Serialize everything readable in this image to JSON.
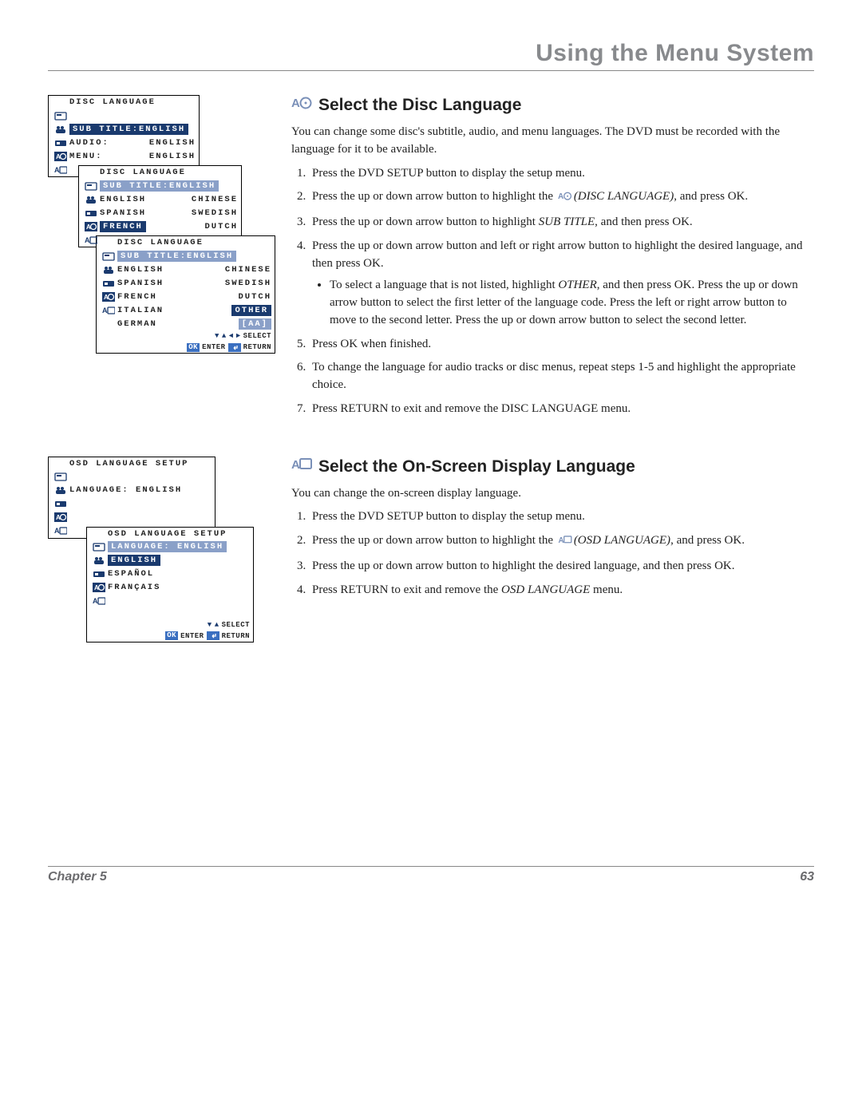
{
  "header": {
    "title": "Using the Menu System"
  },
  "footer": {
    "chapter": "Chapter 5",
    "page": "63"
  },
  "section1": {
    "title": "Select the Disc Language",
    "intro": "You can change some disc's subtitle, audio, and menu languages. The DVD must be recorded with the language for it to be available.",
    "steps": {
      "s1": "Press the DVD SETUP button to display the setup menu.",
      "s2a": "Press the up or down arrow button to highlight the ",
      "s2b": "(DISC LANGUAGE)",
      "s2c": ", and press OK.",
      "s3a": "Press the up or down arrow button to highlight ",
      "s3b": "SUB TITLE",
      "s3c": ", and then press OK.",
      "s4": "Press the up or down arrow button and left or right arrow button to highlight the desired language, and then press OK.",
      "s4bul_a": "To select a language that is not listed, highlight ",
      "s4bul_b": "OTHER",
      "s4bul_c": ", and then press OK. Press the up or down arrow button to select the first letter of the language code. Press the left or right arrow button to move to the second letter. Press the up or down arrow button to select the second letter.",
      "s5": "Press OK when finished.",
      "s6": "To change the language for audio tracks or disc menus, repeat steps 1-5 and highlight the appropriate choice.",
      "s7": "Press RETURN to exit and remove the DISC LANGUAGE menu."
    }
  },
  "section2": {
    "title": "Select the On-Screen Display Language",
    "intro": "You can change the on-screen display language.",
    "steps": {
      "s1": "Press the DVD SETUP button to display the setup menu.",
      "s2a": "Press the up or down arrow button to highlight the ",
      "s2b": "(OSD LANGUAGE)",
      "s2c": ", and press OK.",
      "s3": "Press the up or down arrow button to highlight the desired language, and then press OK.",
      "s4a": "Press RETURN to exit and remove the ",
      "s4b": "OSD LANGUAGE",
      "s4c": " menu."
    }
  },
  "fig1": {
    "p1": {
      "title": "DISC LANGUAGE",
      "sub": "SUB TITLE:ENGLISH",
      "audio_label": "AUDIO:",
      "audio_value": "ENGLISH",
      "menu_label": "MENU:",
      "menu_value": "ENGLISH"
    },
    "p2": {
      "title": "DISC LANGUAGE",
      "sub": "SUB TITLE:ENGLISH",
      "r1a": "ENGLISH",
      "r1b": "CHINESE",
      "r2a": "SPANISH",
      "r2b": "SWEDISH",
      "r3a": "FRENCH",
      "r3b": "DUTCH"
    },
    "p3": {
      "title": "DISC LANGUAGE",
      "sub": "SUB TITLE:ENGLISH",
      "r1a": "ENGLISH",
      "r1b": "CHINESE",
      "r2a": "SPANISH",
      "r2b": "SWEDISH",
      "r3a": "FRENCH",
      "r3b": "DUTCH",
      "r4a": "ITALIAN",
      "r4b": "OTHER",
      "r5a": "GERMAN",
      "r5b": "[AA]",
      "foot_select": "SELECT",
      "foot_ok": "OK",
      "foot_enter": "ENTER",
      "foot_return": "RETURN"
    }
  },
  "fig2": {
    "p1": {
      "title": "OSD LANGUAGE SETUP",
      "lang_label": "LANGUAGE:",
      "lang_value": "ENGLISH"
    },
    "p2": {
      "title": "OSD LANGUAGE SETUP",
      "lang_line": "LANGUAGE: ENGLISH",
      "o1": "ENGLISH",
      "o2": "ESPAÑOL",
      "o3": "FRANÇAIS",
      "foot_select": "SELECT",
      "foot_ok": "OK",
      "foot_enter": "ENTER",
      "foot_return": "RETURN"
    }
  }
}
